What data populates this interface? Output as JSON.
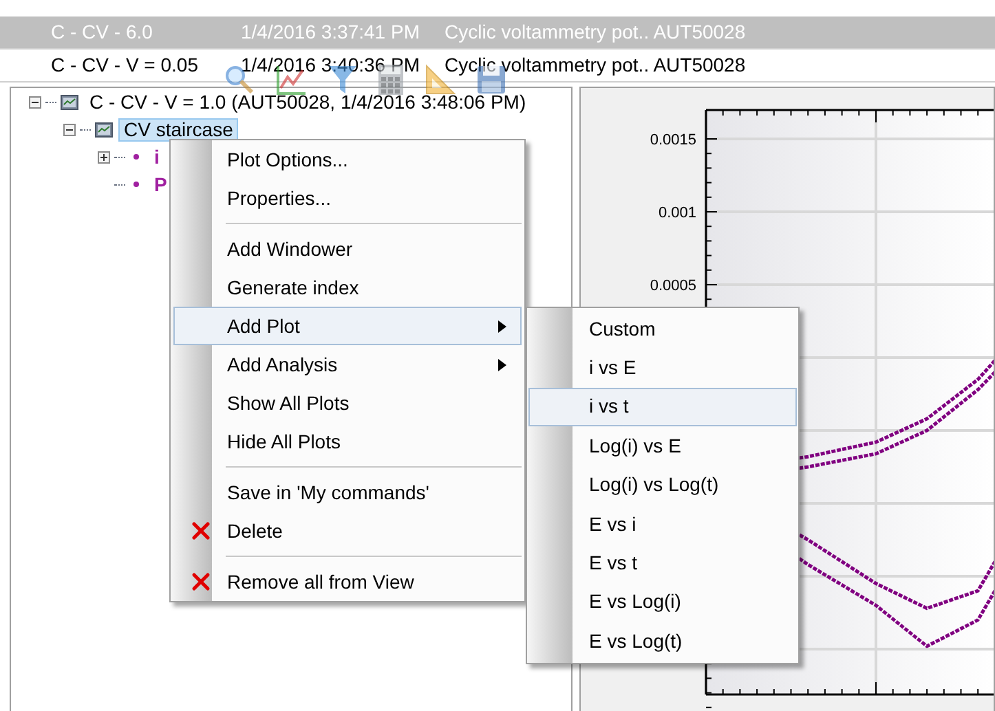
{
  "list_rows": [
    {
      "name": "C - CV - 6.0",
      "date": "1/4/2016 3:37:41 PM",
      "procedure": "Cyclic voltammetry pot.. AUT50028",
      "selected": true
    },
    {
      "name": "C - CV - V = 0.05",
      "date": "1/4/2016 3:40:36 PM",
      "procedure": "Cyclic voltammetry pot.. AUT50028",
      "selected": false
    }
  ],
  "tree": [
    {
      "label": "C - CV - V = 1.0 (AUT50028, 1/4/2016 3:48:06 PM)",
      "kind": "node",
      "expanded": true,
      "selected": false,
      "children": [
        {
          "label": "CV staircase",
          "kind": "node",
          "expanded": true,
          "selected": true,
          "children": [
            {
              "label": "i",
              "kind": "plot",
              "expanded": false,
              "selected": false
            },
            {
              "label": "P",
              "kind": "plot",
              "selected": false
            }
          ]
        }
      ]
    }
  ],
  "context_menu": [
    {
      "label": "Plot Options...",
      "kind": "item",
      "selected": false
    },
    {
      "label": "Properties...",
      "kind": "item",
      "selected": false
    },
    {
      "kind": "separator"
    },
    {
      "label": "Add Windower",
      "kind": "item",
      "selected": false
    },
    {
      "label": "Generate index",
      "kind": "item",
      "selected": false
    },
    {
      "label": "Add Plot",
      "kind": "submenu",
      "selected": true
    },
    {
      "label": "Add Analysis",
      "kind": "submenu",
      "selected": false
    },
    {
      "label": "Show All Plots",
      "kind": "item",
      "selected": false
    },
    {
      "label": "Hide All Plots",
      "kind": "item",
      "selected": false
    },
    {
      "kind": "separator"
    },
    {
      "label": "Save in 'My commands'",
      "kind": "item",
      "selected": false
    },
    {
      "label": "Delete",
      "kind": "delete",
      "selected": false
    },
    {
      "kind": "separator"
    },
    {
      "label": "Remove all from View",
      "kind": "delete",
      "selected": false
    }
  ],
  "submenu": [
    {
      "label": "Custom",
      "selected": false
    },
    {
      "label": "i vs E",
      "selected": false
    },
    {
      "label": "i vs t",
      "selected": true
    },
    {
      "label": "Log(i) vs E",
      "selected": false
    },
    {
      "label": "Log(i) vs Log(t)",
      "selected": false
    },
    {
      "label": "E vs i",
      "selected": false
    },
    {
      "label": "E vs t",
      "selected": false
    },
    {
      "label": "E vs Log(i)",
      "selected": false
    },
    {
      "label": "E vs Log(t)",
      "selected": false
    }
  ],
  "plot": {
    "y_tick_labels": [
      "0.0015",
      "0.001",
      "0.0005"
    ]
  }
}
